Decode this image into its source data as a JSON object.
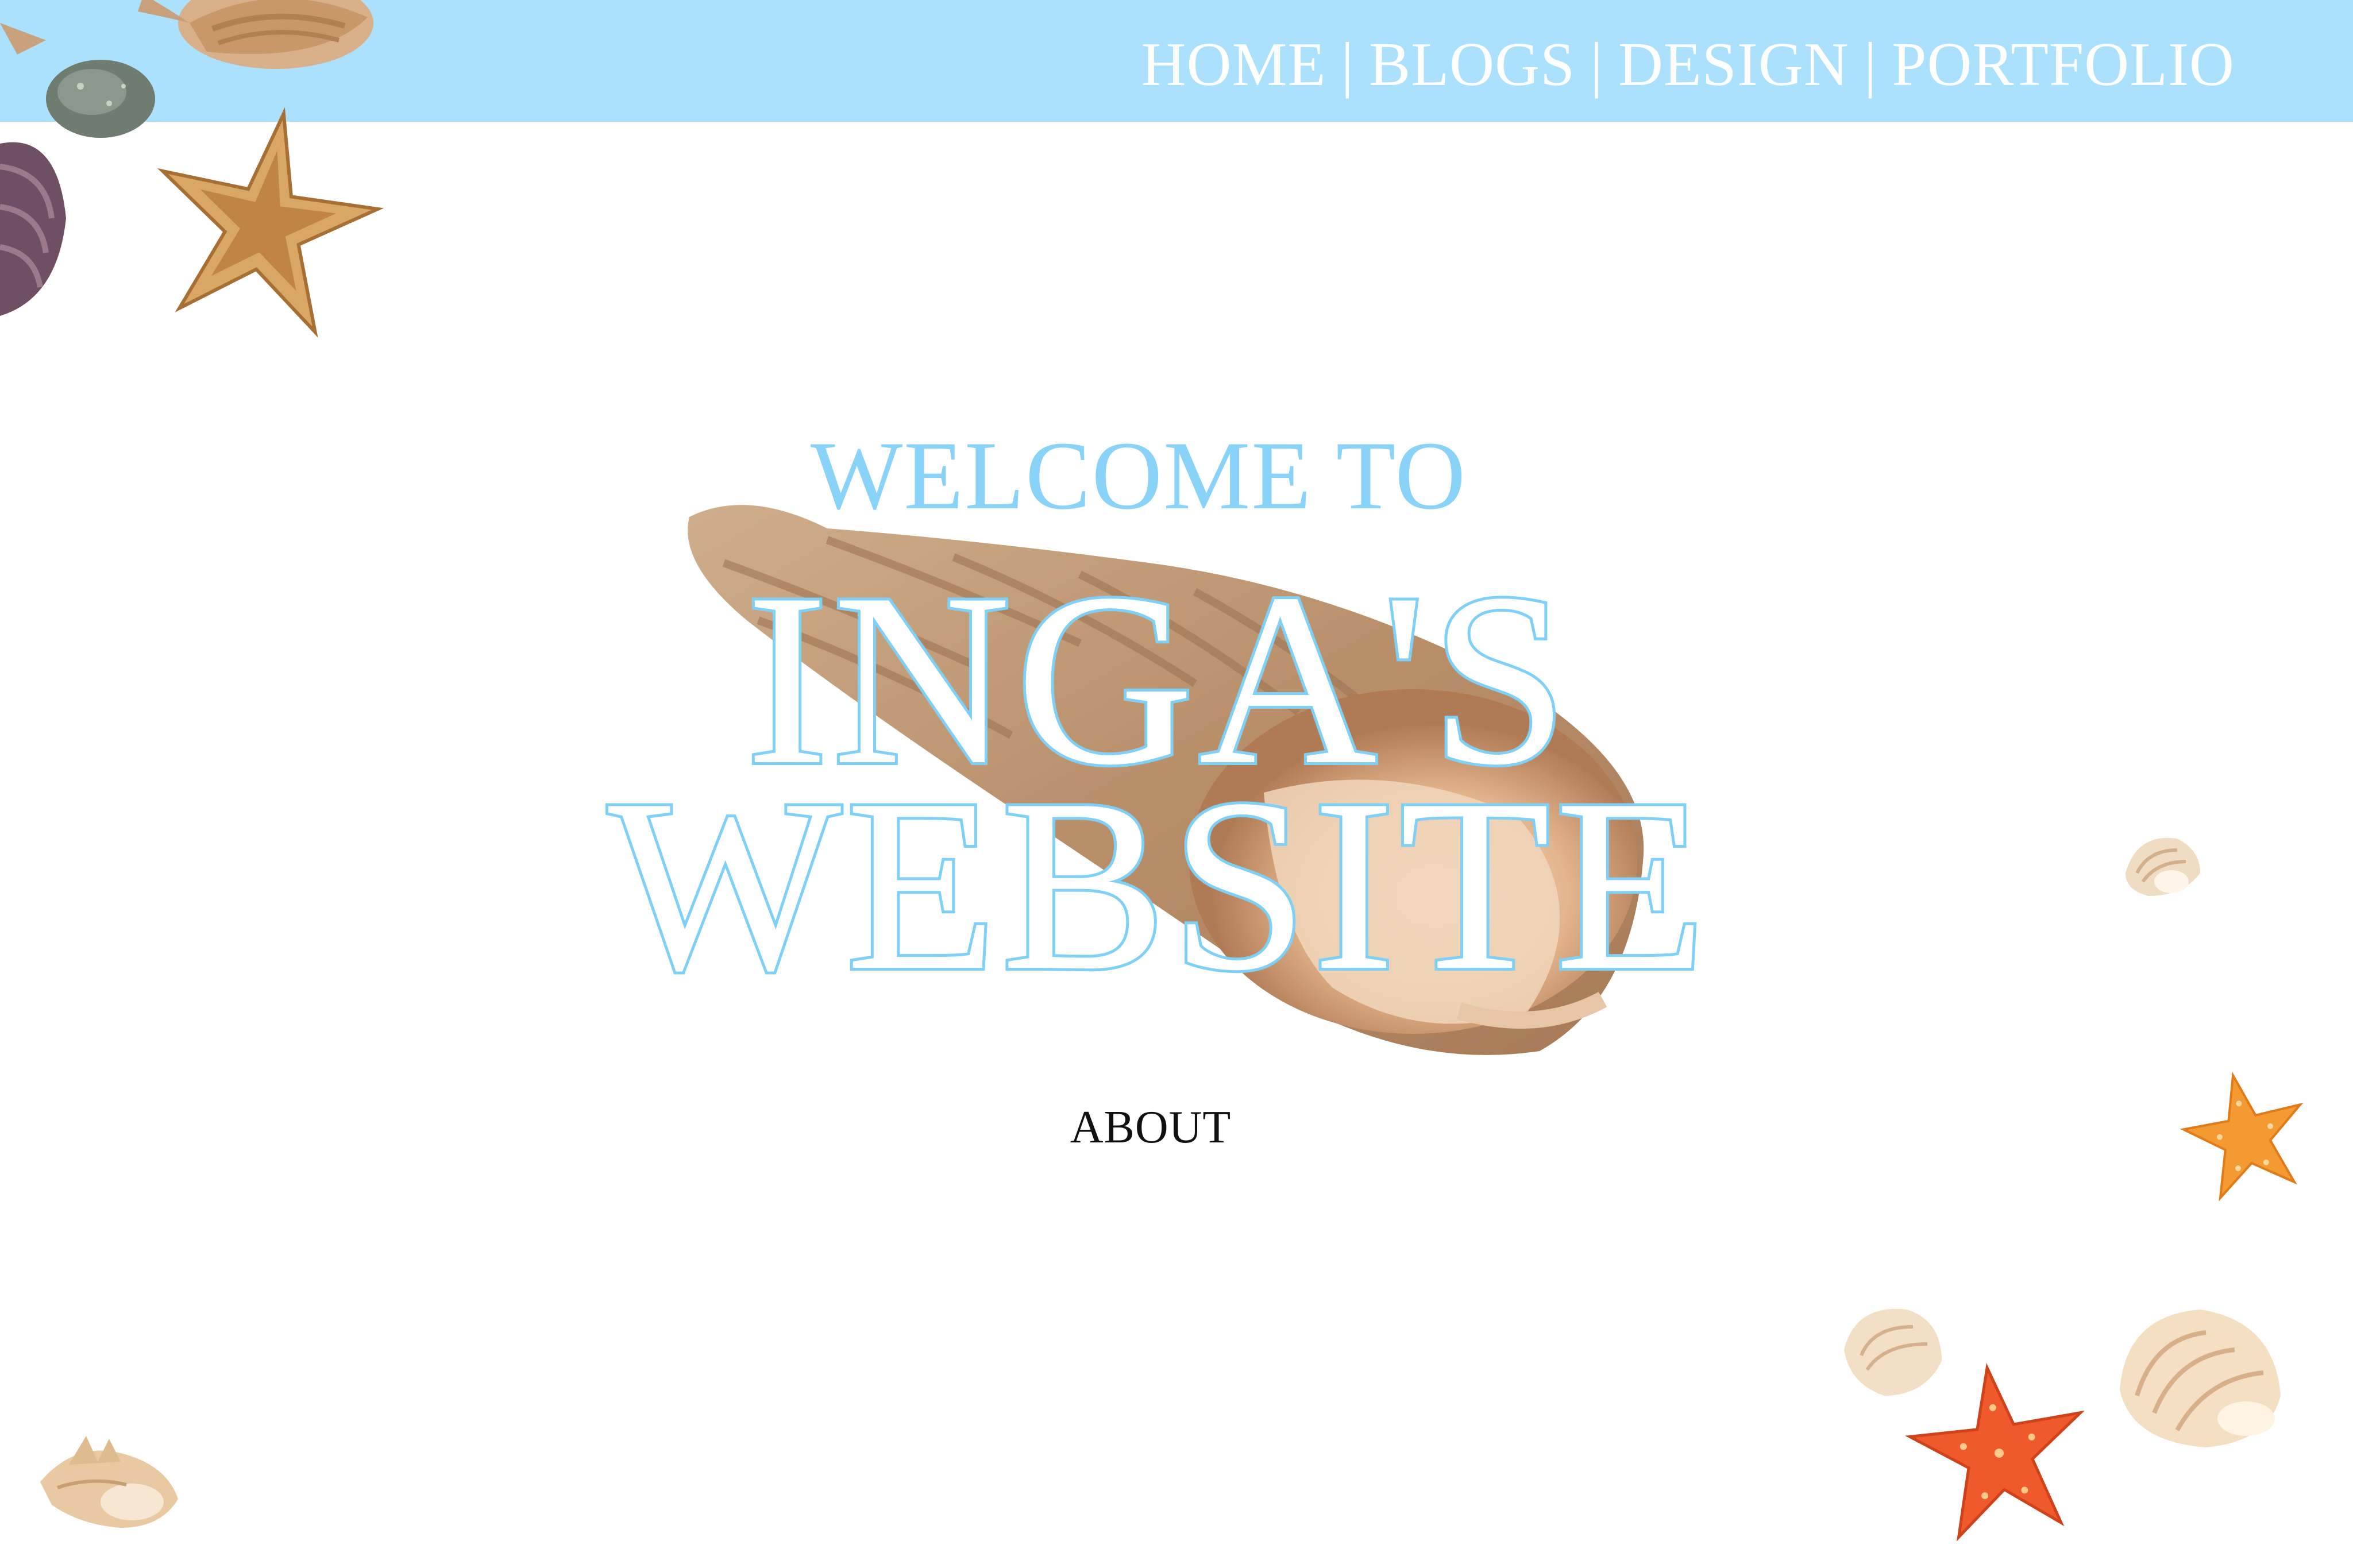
{
  "nav": {
    "items": [
      {
        "label": "HOME"
      },
      {
        "label": "BLOGS"
      },
      {
        "label": "DESIGN"
      },
      {
        "label": "PORTFOLIO"
      }
    ],
    "separator": "|"
  },
  "hero": {
    "welcome": "WELCOME TO",
    "line1": "INGA'S",
    "line2": "WEBSITE"
  },
  "about_link": "ABOUT",
  "colors": {
    "topbar": "#abe1fc",
    "accent": "#7fd0f7",
    "nav_text": "#ffffff"
  },
  "decorations": [
    "conch-shell-image",
    "starfish-image",
    "scallop-shell-image",
    "pebble-image"
  ]
}
